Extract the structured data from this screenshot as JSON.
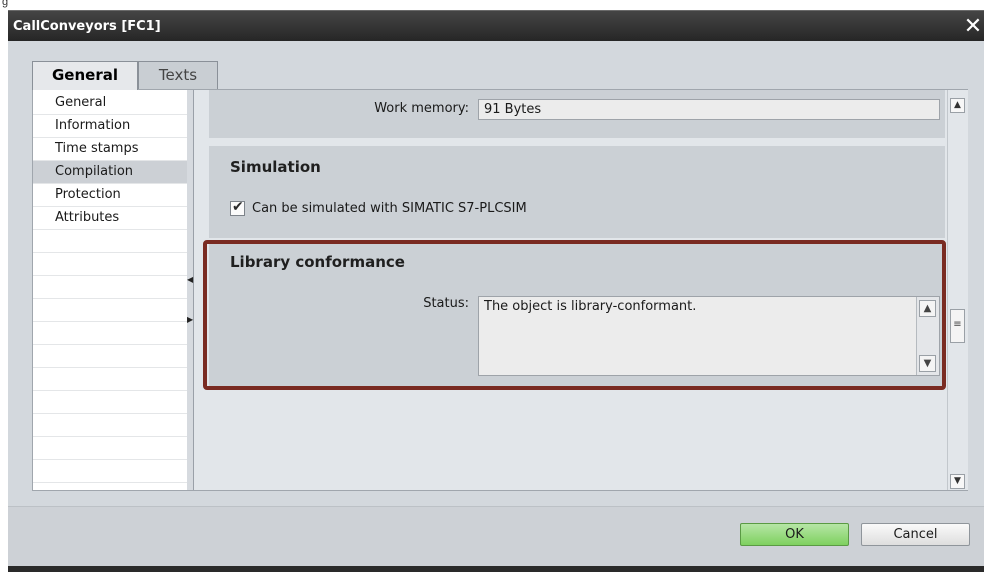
{
  "figure_label": "g",
  "window": {
    "title": "CallConveyors [FC1]",
    "close_glyph": "✕"
  },
  "tabs": [
    {
      "label": "General",
      "active": true
    },
    {
      "label": "Texts",
      "active": false
    }
  ],
  "sidebar": {
    "items": [
      {
        "label": "General"
      },
      {
        "label": "Information"
      },
      {
        "label": "Time stamps"
      },
      {
        "label": "Compilation",
        "active": true
      },
      {
        "label": "Protection"
      },
      {
        "label": "Attributes"
      }
    ],
    "collapse_left_glyph": "◀",
    "expand_right_glyph": "▶"
  },
  "compilation": {
    "work_memory_label": "Work memory:",
    "work_memory_value": "91 Bytes"
  },
  "simulation": {
    "title": "Simulation",
    "checkbox_label": "Can be simulated with SIMATIC S7-PLCSIM",
    "checked": true,
    "check_glyph": "✔"
  },
  "library_conformance": {
    "title": "Library conformance",
    "status_label": "Status:",
    "status_value": "The object is library-conformant."
  },
  "scroll_glyphs": {
    "up": "▲",
    "down": "▼",
    "grip": "≡"
  },
  "footer": {
    "ok_label": "OK",
    "cancel_label": "Cancel"
  },
  "colors": {
    "titlebar": "#262626",
    "highlight_border": "#7a2b22",
    "ok_button": "#7ed15f"
  }
}
